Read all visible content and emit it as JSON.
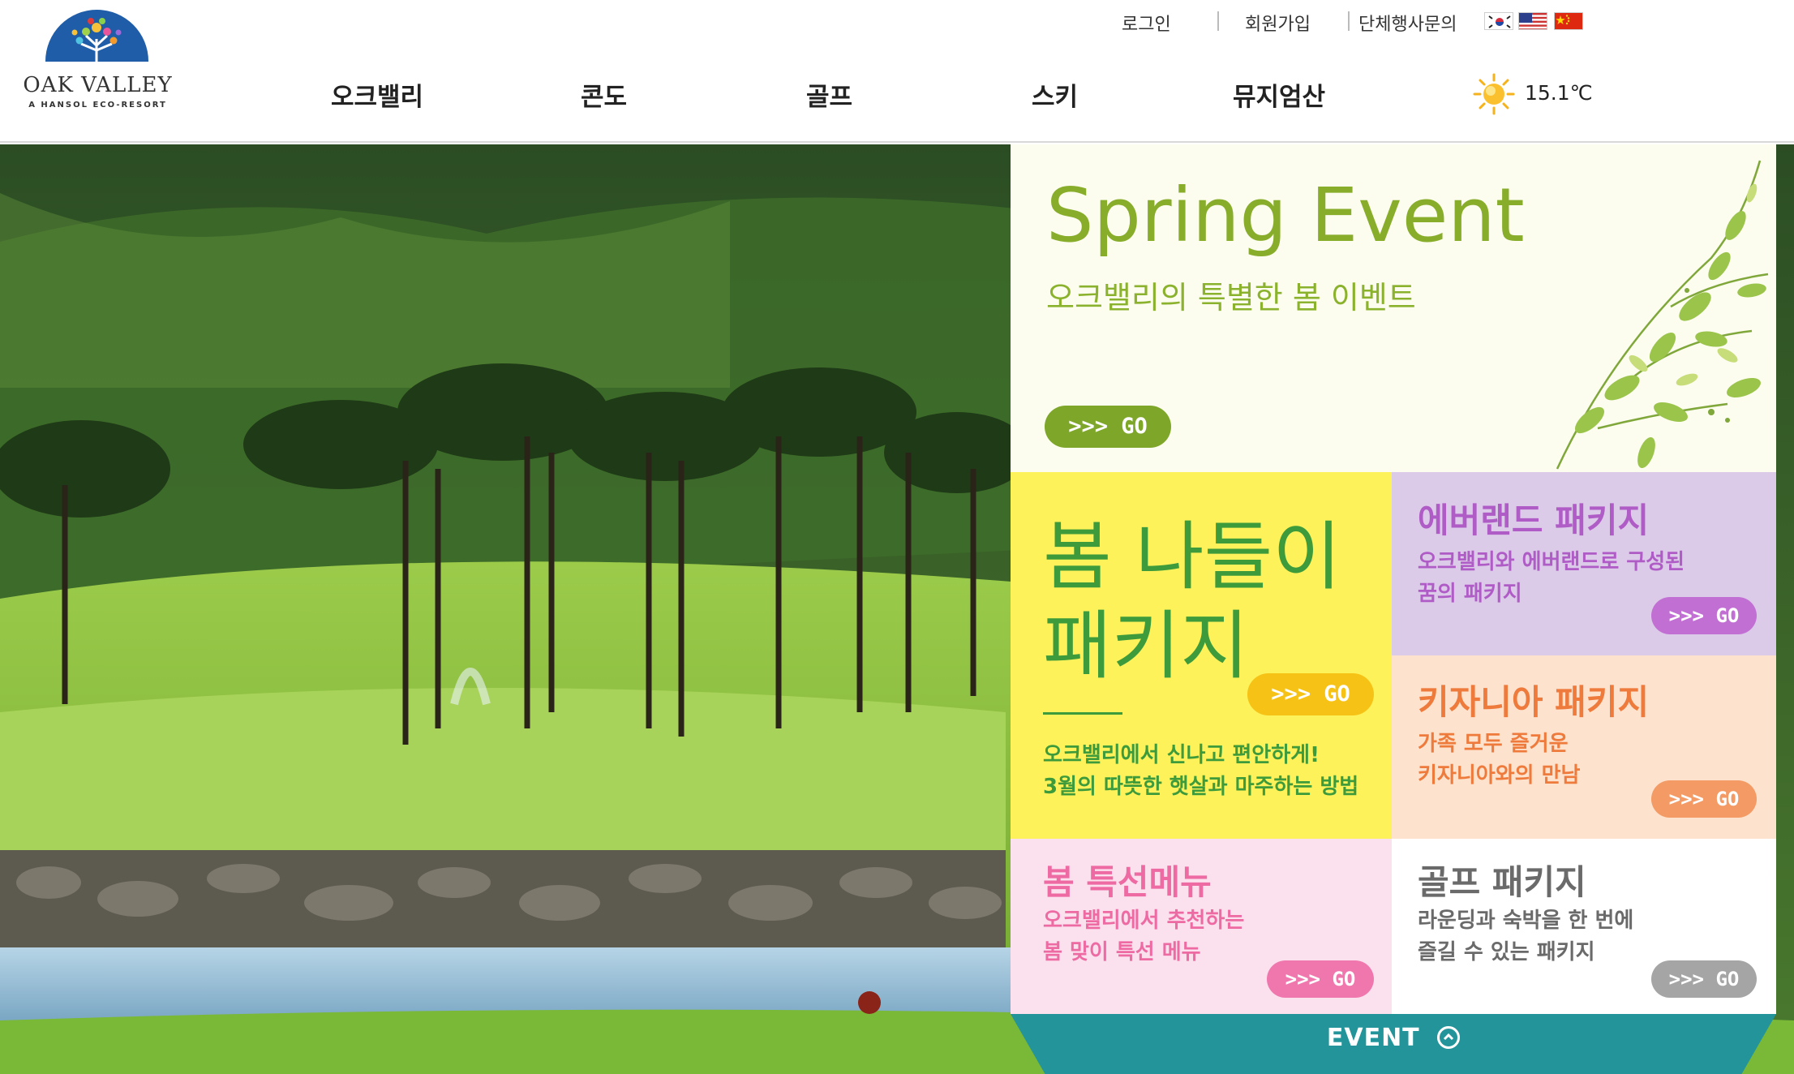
{
  "logo": {
    "name": "OAK VALLEY",
    "tagline": "A HANSOL ECO-RESORT"
  },
  "util_links": {
    "login": "로그인",
    "signup": "회원가입",
    "group": "단체행사문의"
  },
  "languages": [
    "ko-flag-icon",
    "us-flag-icon",
    "cn-flag-icon"
  ],
  "nav": [
    "오크밸리",
    "콘도",
    "골프",
    "스키",
    "뮤지엄산"
  ],
  "weather": {
    "icon": "sun-icon",
    "temperature": "15.1℃"
  },
  "event": {
    "title": "Spring Event",
    "subtitle": "오크밸리의 특별한 봄 이벤트",
    "go_label": ">>> GO",
    "packages": [
      {
        "title_line1": "봄 나들이",
        "title_line2": "패키지",
        "description": "오크밸리에서 신나고 편안하게!\n3월의 따뜻한 햇살과 마주하는 방법",
        "go_label": ">>> GO",
        "color": "#fdf25a"
      },
      {
        "title": "에버랜드 패키지",
        "description": "오크밸리와 에버랜드로 구성된\n꿈의 패키지",
        "go_label": ">>> GO",
        "color": "#dccbe8"
      },
      {
        "title": "키자니아 패키지",
        "description": "가족 모두 즐거운\n키자니아와의 만남",
        "go_label": ">>> GO",
        "color": "#fde2cd"
      },
      {
        "title": "봄 특선메뉴",
        "description": "오크밸리에서 추천하는\n봄 맞이 특선 메뉴",
        "go_label": ">>> GO",
        "color": "#fbe1ee"
      },
      {
        "title": "골프 패키지",
        "description": "라운딩과 숙박을 한 번에\n즐길 수 있는 패키지",
        "go_label": ">>> GO",
        "color": "#ffffff"
      }
    ],
    "bar_label": "EVENT"
  },
  "colors": {
    "accent_green": "#87ad2b",
    "event_bar": "#23959a"
  }
}
